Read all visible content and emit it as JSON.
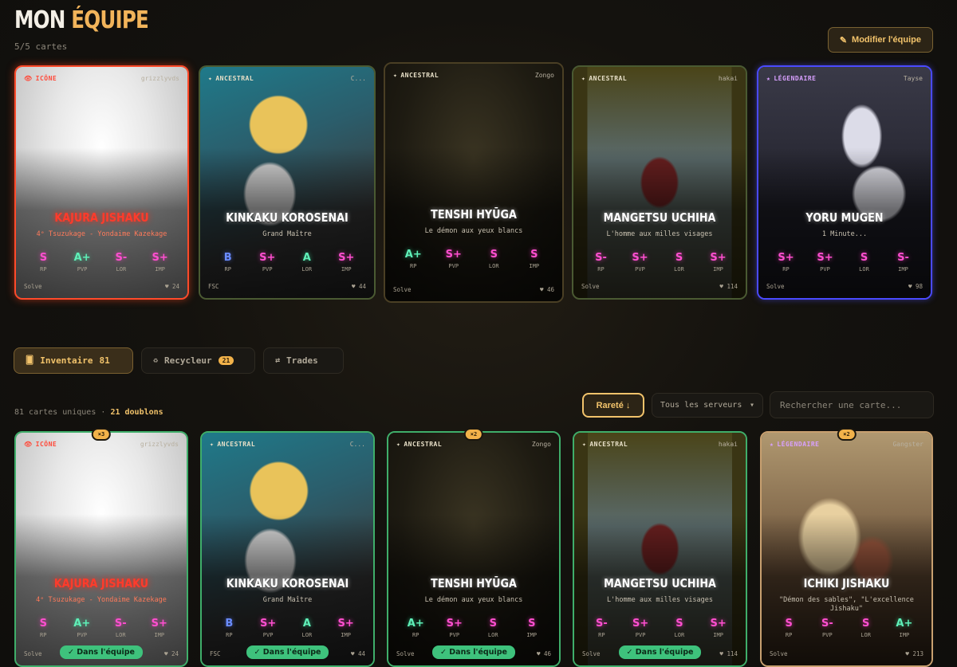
{
  "header": {
    "title_main": "MON",
    "title_accent": "ÉQUIPE",
    "count": "5/5 cartes",
    "edit_button": "Modifier l'équipe",
    "edit_icon": "✎"
  },
  "team": [
    {
      "rarity": "ICÔNE",
      "rarity_icon": "👁",
      "author": "grizzlyvds",
      "name": "KAJURA JISHAKU",
      "subtitle": "4ᵉ Tsuzukage - Yondaime Kazekage",
      "stats": [
        {
          "g": "S",
          "l": "RP",
          "c": "pink"
        },
        {
          "g": "A+",
          "l": "PVP",
          "c": "green"
        },
        {
          "g": "S-",
          "l": "LOR",
          "c": "pink"
        },
        {
          "g": "S+",
          "l": "IMP",
          "c": "pink"
        }
      ],
      "foot_left": "Solve",
      "likes": "♥ 24"
    },
    {
      "rarity": "ANCESTRAL",
      "rarity_icon": "✦",
      "author": "C...",
      "name": "KINKAKU KOROSENAI",
      "subtitle": "Grand Maître",
      "stats": [
        {
          "g": "B",
          "l": "RP",
          "c": "blue"
        },
        {
          "g": "S+",
          "l": "PVP",
          "c": "pink"
        },
        {
          "g": "A",
          "l": "LOR",
          "c": "green"
        },
        {
          "g": "S+",
          "l": "IMP",
          "c": "pink"
        }
      ],
      "foot_left": "FSC",
      "likes": "♥ 44"
    },
    {
      "rarity": "ANCESTRAL",
      "rarity_icon": "✦",
      "author": "Zongo",
      "name": "TENSHI HYŪGA",
      "subtitle": "Le démon aux yeux blancs",
      "stats": [
        {
          "g": "A+",
          "l": "RP",
          "c": "green"
        },
        {
          "g": "S+",
          "l": "PVP",
          "c": "pink"
        },
        {
          "g": "S",
          "l": "LOR",
          "c": "pink"
        },
        {
          "g": "S",
          "l": "IMP",
          "c": "pink"
        }
      ],
      "foot_left": "Solve",
      "likes": "♥ 46"
    },
    {
      "rarity": "ANCESTRAL",
      "rarity_icon": "✦",
      "author": "hakai",
      "name": "MANGETSU UCHIHA",
      "subtitle": "L'homme aux milles visages",
      "stats": [
        {
          "g": "S-",
          "l": "RP",
          "c": "pink"
        },
        {
          "g": "S+",
          "l": "PVP",
          "c": "pink"
        },
        {
          "g": "S",
          "l": "LOR",
          "c": "pink"
        },
        {
          "g": "S+",
          "l": "IMP",
          "c": "pink"
        }
      ],
      "foot_left": "Solve",
      "likes": "♥ 114"
    },
    {
      "rarity": "LÉGENDAIRE",
      "rarity_icon": "★",
      "author": "Tayse",
      "name": "YORU MUGEN",
      "subtitle": "1 Minute...",
      "stats": [
        {
          "g": "S+",
          "l": "RP",
          "c": "pink"
        },
        {
          "g": "S+",
          "l": "PVP",
          "c": "pink"
        },
        {
          "g": "S",
          "l": "LOR",
          "c": "pink"
        },
        {
          "g": "S-",
          "l": "IMP",
          "c": "pink"
        }
      ],
      "foot_left": "Solve",
      "likes": "♥ 98"
    }
  ],
  "tabs": [
    {
      "label": "Inventaire",
      "count": "81",
      "icon": "🂠"
    },
    {
      "label": "Recycleur",
      "count": "21",
      "icon": "♻"
    },
    {
      "label": "Trades",
      "icon": "⇄"
    }
  ],
  "inventory": {
    "unique": "81 cartes uniques",
    "sep": "·",
    "duplicates": "21 doublons",
    "sort_label": "Rareté ↓",
    "server_select": "Tous les serveurs",
    "server_arrow": "▾",
    "search_placeholder": "Rechercher une carte..."
  },
  "inv_cards": [
    {
      "badge": "×3",
      "rarity": "ICÔNE",
      "rarity_icon": "👁",
      "author": "grizzlyvds",
      "name": "KAJURA JISHAKU",
      "subtitle": "4ᵉ Tsuzukage - Yondaime Kazekage",
      "stats": [
        {
          "g": "S",
          "l": "RP",
          "c": "pink"
        },
        {
          "g": "A+",
          "l": "PVP",
          "c": "green"
        },
        {
          "g": "S-",
          "l": "LOR",
          "c": "pink"
        },
        {
          "g": "S+",
          "l": "IMP",
          "c": "pink"
        }
      ],
      "foot_left": "Solve",
      "likes": "♥ 24",
      "in_team": "✓ Dans l'équipe"
    },
    {
      "badge": "",
      "rarity": "ANCESTRAL",
      "rarity_icon": "✦",
      "author": "C...",
      "name": "KINKAKU KOROSENAI",
      "subtitle": "Grand Maître",
      "stats": [
        {
          "g": "B",
          "l": "RP",
          "c": "blue"
        },
        {
          "g": "S+",
          "l": "PVP",
          "c": "pink"
        },
        {
          "g": "A",
          "l": "LOR",
          "c": "green"
        },
        {
          "g": "S+",
          "l": "IMP",
          "c": "pink"
        }
      ],
      "foot_left": "FSC",
      "likes": "♥ 44",
      "in_team": "✓ Dans l'équipe"
    },
    {
      "badge": "×2",
      "rarity": "ANCESTRAL",
      "rarity_icon": "✦",
      "author": "Zongo",
      "name": "TENSHI HYŪGA",
      "subtitle": "Le démon aux yeux blancs",
      "stats": [
        {
          "g": "A+",
          "l": "RP",
          "c": "green"
        },
        {
          "g": "S+",
          "l": "PVP",
          "c": "pink"
        },
        {
          "g": "S",
          "l": "LOR",
          "c": "pink"
        },
        {
          "g": "S",
          "l": "IMP",
          "c": "pink"
        }
      ],
      "foot_left": "Solve",
      "likes": "♥ 46",
      "in_team": "✓ Dans l'équipe"
    },
    {
      "badge": "",
      "rarity": "ANCESTRAL",
      "rarity_icon": "✦",
      "author": "hakai",
      "name": "MANGETSU UCHIHA",
      "subtitle": "L'homme aux milles visages",
      "stats": [
        {
          "g": "S-",
          "l": "RP",
          "c": "pink"
        },
        {
          "g": "S+",
          "l": "PVP",
          "c": "pink"
        },
        {
          "g": "S",
          "l": "LOR",
          "c": "pink"
        },
        {
          "g": "S+",
          "l": "IMP",
          "c": "pink"
        }
      ],
      "foot_left": "Solve",
      "likes": "♥ 114",
      "in_team": "✓ Dans l'équipe"
    },
    {
      "badge": "×2",
      "rarity": "LÉGENDAIRE",
      "rarity_icon": "★",
      "author": "Gangster",
      "name": "ICHIKI JISHAKU",
      "subtitle": "\"Démon des sables\", \"L'excellence Jishaku\"",
      "stats": [
        {
          "g": "S",
          "l": "RP",
          "c": "pink"
        },
        {
          "g": "S-",
          "l": "PVP",
          "c": "pink"
        },
        {
          "g": "S",
          "l": "LOR",
          "c": "pink"
        },
        {
          "g": "A+",
          "l": "IMP",
          "c": "green"
        }
      ],
      "foot_left": "Solve",
      "likes": "♥ 213",
      "in_team": ""
    }
  ]
}
